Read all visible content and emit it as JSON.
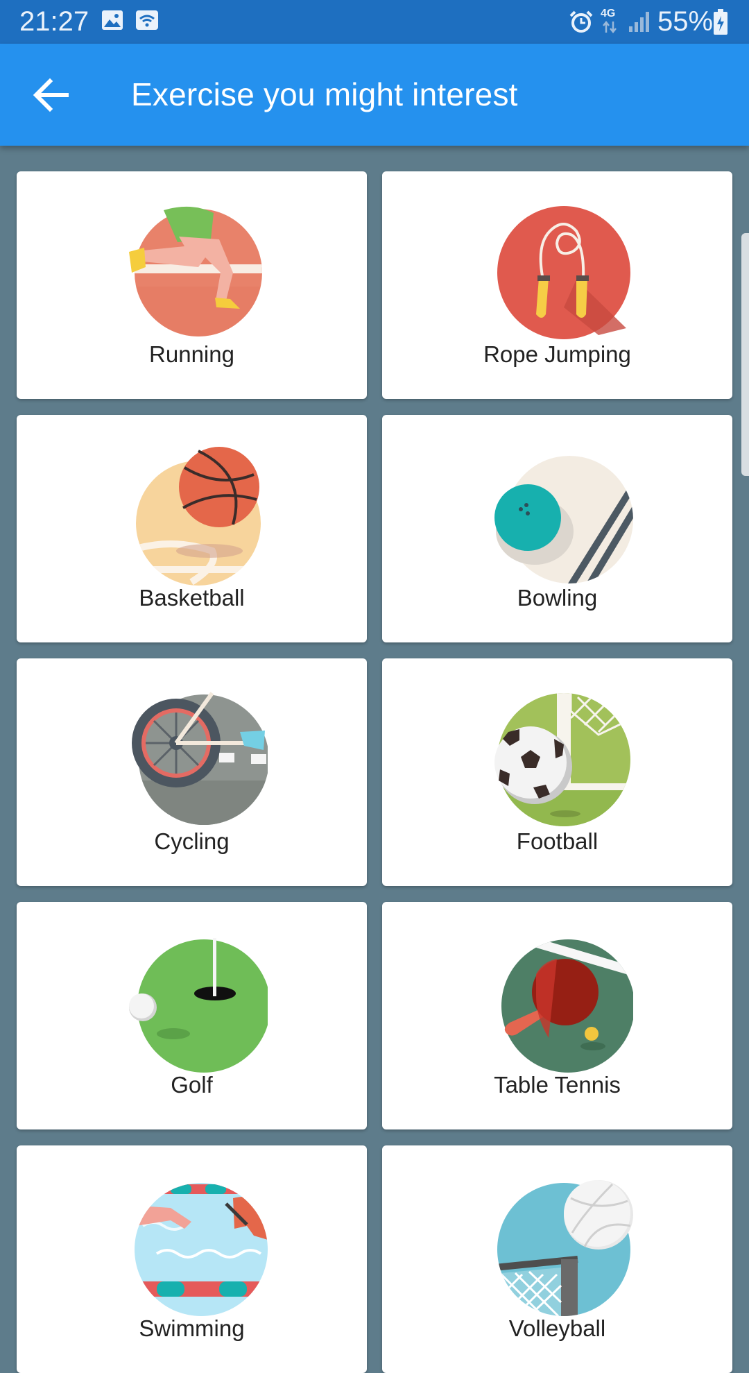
{
  "status_bar": {
    "time": "21:27",
    "network": "4G",
    "battery": "55%",
    "icons": [
      "image-icon",
      "wifi-icon",
      "alarm-icon",
      "data-arrows-icon",
      "signal-icon",
      "battery-charging-icon"
    ]
  },
  "app_bar": {
    "back_icon": "arrow-left-icon",
    "title": "Exercise you might interest"
  },
  "colors": {
    "status_bar": "#1e6fc0",
    "app_bar": "#2591ee",
    "background": "#5e7c8b",
    "card": "#ffffff"
  },
  "exercises": [
    {
      "label": "Running",
      "icon": "running-icon"
    },
    {
      "label": "Rope Jumping",
      "icon": "rope-jumping-icon"
    },
    {
      "label": "Basketball",
      "icon": "basketball-icon"
    },
    {
      "label": "Bowling",
      "icon": "bowling-icon"
    },
    {
      "label": "Cycling",
      "icon": "cycling-icon"
    },
    {
      "label": "Football",
      "icon": "football-icon"
    },
    {
      "label": "Golf",
      "icon": "golf-icon"
    },
    {
      "label": "Table Tennis",
      "icon": "table-tennis-icon"
    },
    {
      "label": "Swimming",
      "icon": "swimming-icon"
    },
    {
      "label": "Volleyball",
      "icon": "volleyball-icon"
    }
  ]
}
